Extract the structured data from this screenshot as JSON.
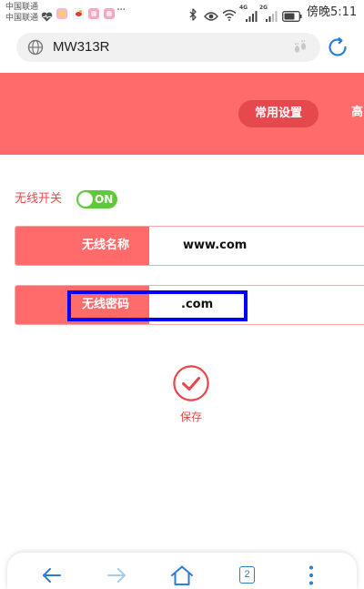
{
  "status_bar": {
    "carriers": [
      "中国联通",
      "中国联通"
    ],
    "notification_icons": [
      "heart-icon",
      "app-icon",
      "weibo-icon",
      "app-icon",
      "app-icon"
    ],
    "more": "···",
    "sim1_network": "4G",
    "sim2_network": "2G",
    "system_icons": [
      "bluetooth-icon",
      "eye-icon",
      "wifi-icon",
      "signal-icon",
      "signal-icon",
      "battery-icon"
    ],
    "time": "傍晚5:11"
  },
  "address_bar": {
    "left_icon": "globe-icon",
    "url": "MW313R",
    "right_icon": "footprint-icon",
    "refresh_icon": "refresh-icon"
  },
  "header": {
    "tabs": [
      {
        "label": "常用设置",
        "active": true
      },
      {
        "label": "高",
        "active": false
      }
    ]
  },
  "wireless_switch": {
    "label": "无线开关",
    "state": "ON"
  },
  "fields": [
    {
      "label": "无线名称",
      "value": "www.com"
    },
    {
      "label": "无线密码",
      "value": ".com"
    }
  ],
  "save": {
    "icon": "check-circle-icon",
    "label": "保存"
  },
  "bottom_nav": {
    "items": [
      {
        "icon": "back-arrow-icon",
        "enabled": true
      },
      {
        "icon": "forward-arrow-icon",
        "enabled": false
      },
      {
        "icon": "home-icon",
        "enabled": true
      },
      {
        "icon": "tabs-icon",
        "count": "2",
        "enabled": true
      },
      {
        "icon": "more-icon",
        "enabled": true
      }
    ]
  },
  "colors": {
    "header_bg": "#FF6B6B",
    "active_tab_bg": "#E5484D",
    "accent_red": "#E8474A",
    "field_label_bg": "#FF6B6B",
    "field_border": "#F6A8A8",
    "toggle_on": "#5FC93B",
    "nav_blue": "#2B7DD6",
    "nav_disabled": "#A9CBEE",
    "highlight_box": "#0000FF"
  }
}
